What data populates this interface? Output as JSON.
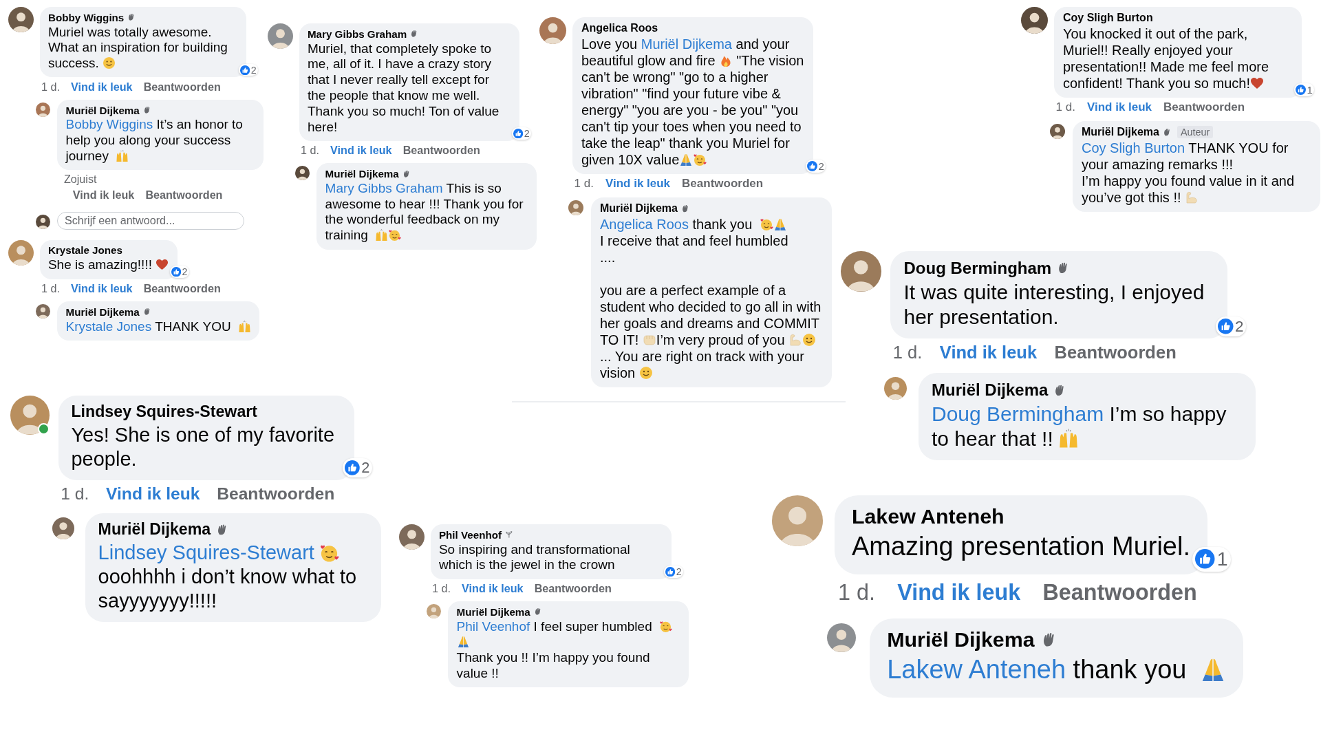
{
  "threads": [
    {
      "comments": [
        {
          "author": "Bobby Wiggins",
          "wave_badge": true,
          "sprout_badge": false,
          "online": false,
          "body": [
            {
              "kind": "text",
              "text": "Muriel was totally awesome. What an inspiration for building success. "
            },
            {
              "kind": "smile"
            }
          ],
          "reactions": "2",
          "time": "1 d.",
          "like_label": "Vind ik leuk",
          "liked": true,
          "reply_label": "Beantwoorden",
          "replies": [
            {
              "author": "Muriël Dijkema",
              "wave_badge": true,
              "sprout_badge": false,
              "body": [
                {
                  "kind": "mention",
                  "text": "Bobby Wiggins"
                },
                {
                  "kind": "text",
                  "text": " It’s an honor to help you along your success journey "
                },
                {
                  "kind": "raised-hands"
                }
              ],
              "time": "Zojuist",
              "like_label": "Vind ik leuk",
              "liked": false,
              "reply_label": "Beantwoorden"
            }
          ],
          "reply_field": {
            "placeholder": "Schrijf een antwoord..."
          }
        },
        {
          "author": "Krystale Jones",
          "wave_badge": false,
          "sprout_badge": false,
          "online": false,
          "body": [
            {
              "kind": "text",
              "text": "She is amazing!!!! "
            },
            {
              "kind": "heart"
            }
          ],
          "reactions": "2",
          "time": "1 d.",
          "like_label": "Vind ik leuk",
          "liked": true,
          "reply_label": "Beantwoorden",
          "replies": [
            {
              "author": "Muriël Dijkema",
              "wave_badge": true,
              "sprout_badge": false,
              "body": [
                {
                  "kind": "mention",
                  "text": "Krystale Jones"
                },
                {
                  "kind": "text",
                  "text": " THANK YOU "
                },
                {
                  "kind": "raised-hands"
                }
              ]
            }
          ]
        }
      ]
    },
    {
      "comments": [
        {
          "author": "Lindsey Squires-Stewart",
          "wave_badge": false,
          "sprout_badge": false,
          "online": true,
          "body": [
            {
              "kind": "text",
              "text": "Yes! She is one of my favorite people."
            }
          ],
          "reactions": "2",
          "time": "1 d.",
          "like_label": "Vind ik leuk",
          "liked": true,
          "reply_label": "Beantwoorden",
          "replies": [
            {
              "author": "Muriël Dijkema",
              "wave_badge": true,
              "sprout_badge": false,
              "body": [
                {
                  "kind": "mention",
                  "text": "Lindsey Squires-Stewart"
                },
                {
                  "kind": "hearts-face"
                },
                {
                  "kind": "text",
                  "text": "\nooohhhh i don’t know what to sayyyyyyy!!!!!"
                }
              ]
            }
          ]
        }
      ]
    },
    {
      "comments": [
        {
          "author": "Mary Gibbs Graham",
          "wave_badge": true,
          "sprout_badge": false,
          "online": false,
          "body": [
            {
              "kind": "text",
              "text": "Muriel, that completely spoke to me, all of it.  I have a crazy story that I never really tell except for the people that know me well. Thank you so much!   Ton of value here!"
            }
          ],
          "reactions": "2",
          "time": "1 d.",
          "like_label": "Vind ik leuk",
          "liked": true,
          "reply_label": "Beantwoorden",
          "replies": [
            {
              "author": "Muriël Dijkema",
              "wave_badge": true,
              "sprout_badge": false,
              "body": [
                {
                  "kind": "mention",
                  "text": "Mary Gibbs Graham"
                },
                {
                  "kind": "text",
                  "text": " This is so awesome to hear !!! Thank you for the wonderful feedback on my training "
                },
                {
                  "kind": "raised-hands"
                },
                {
                  "kind": "hearts-face"
                }
              ]
            }
          ]
        }
      ]
    },
    {
      "comments": [
        {
          "author": "Angelica Roos",
          "wave_badge": false,
          "sprout_badge": false,
          "online": false,
          "body": [
            {
              "kind": "text",
              "text": "Love you "
            },
            {
              "kind": "mention",
              "text": "Muriël Dijkema"
            },
            {
              "kind": "text",
              "text": " and your beautiful glow and fire"
            },
            {
              "kind": "fire"
            },
            {
              "kind": "text",
              "text": " \"The vision can't be wrong\" \"go to a higher vibration\" \"find your future vibe & energy\" \"you are you - be you\" \"you can't tip your toes when you need to take the leap\" thank you  Muriel for given 10X value"
            },
            {
              "kind": "pray"
            },
            {
              "kind": "hearts-face"
            }
          ],
          "reactions": "2",
          "time": "1 d.",
          "like_label": "Vind ik leuk",
          "liked": true,
          "reply_label": "Beantwoorden",
          "replies": [
            {
              "author": "Muriël Dijkema",
              "wave_badge": true,
              "sprout_badge": false,
              "body": [
                {
                  "kind": "mention",
                  "text": "Angelica Roos"
                },
                {
                  "kind": "text",
                  "text": " thank you "
                },
                {
                  "kind": "hearts-face"
                },
                {
                  "kind": "pray"
                },
                {
                  "kind": "text",
                  "text": "\nI receive that and feel humbled\n....\n\nyou are a perfect example of a student who decided to go all in with her goals and dreams and COMMIT TO IT! "
                },
                {
                  "kind": "fist"
                },
                {
                  "kind": "text",
                  "text": "I’m very proud of you "
                },
                {
                  "kind": "muscle"
                },
                {
                  "kind": "smile"
                },
                {
                  "kind": "text",
                  "text": " ... You are right on track with your vision "
                },
                {
                  "kind": "smile"
                }
              ]
            }
          ]
        }
      ]
    },
    {
      "comments": [
        {
          "author": "Phil Veenhof",
          "wave_badge": false,
          "sprout_badge": true,
          "online": false,
          "body": [
            {
              "kind": "text",
              "text": "So inspiring and transformational which is the jewel in the crown"
            }
          ],
          "reactions": "2",
          "time": "1 d.",
          "like_label": "Vind ik leuk",
          "liked": true,
          "reply_label": "Beantwoorden",
          "replies": [
            {
              "author": "Muriël Dijkema",
              "wave_badge": true,
              "sprout_badge": false,
              "body": [
                {
                  "kind": "mention",
                  "text": "Phil Veenhof"
                },
                {
                  "kind": "text",
                  "text": " I feel super humbled "
                },
                {
                  "kind": "hearts-face"
                },
                {
                  "kind": "pray"
                },
                {
                  "kind": "text",
                  "text": "\nThank you !! I’m happy you found value !!"
                }
              ]
            }
          ]
        }
      ]
    },
    {
      "comments": [
        {
          "author": "Coy Sligh Burton",
          "wave_badge": false,
          "sprout_badge": false,
          "online": false,
          "body": [
            {
              "kind": "text",
              "text": "You knocked it out of the park, Muriel!! Really enjoyed your presentation!! Made me feel more confident! Thank you so much!"
            },
            {
              "kind": "heart"
            }
          ],
          "reactions": "1",
          "time": "1 d.",
          "like_label": "Vind ik leuk",
          "liked": true,
          "reply_label": "Beantwoorden",
          "replies": [
            {
              "author": "Muriël Dijkema",
              "wave_badge": true,
              "sprout_badge": false,
              "tag": "Auteur",
              "body": [
                {
                  "kind": "mention",
                  "text": "Coy Sligh Burton"
                },
                {
                  "kind": "text",
                  "text": " THANK YOU for your amazing remarks !!!\nI’m happy you found value in it and you’ve got this !!"
                },
                {
                  "kind": "muscle"
                }
              ]
            }
          ]
        }
      ]
    },
    {
      "comments": [
        {
          "author": "Doug Bermingham",
          "wave_badge": true,
          "sprout_badge": false,
          "online": false,
          "body": [
            {
              "kind": "text",
              "text": "It was quite interesting, I enjoyed her presentation."
            }
          ],
          "reactions": "2",
          "time": "1 d.",
          "like_label": "Vind ik leuk",
          "liked": true,
          "reply_label": "Beantwoorden",
          "replies": [
            {
              "author": "Muriël Dijkema",
              "wave_badge": true,
              "sprout_badge": false,
              "body": [
                {
                  "kind": "mention",
                  "text": "Doug Bermingham"
                },
                {
                  "kind": "text",
                  "text": " I’m so happy to hear that !!"
                },
                {
                  "kind": "raised-hands"
                }
              ]
            }
          ]
        }
      ]
    },
    {
      "comments": [
        {
          "author": "Lakew Anteneh",
          "wave_badge": false,
          "sprout_badge": false,
          "online": false,
          "body": [
            {
              "kind": "text",
              "text": "Amazing presentation Muriel."
            }
          ],
          "reactions": "1",
          "time": "1 d.",
          "like_label": "Vind ik leuk",
          "liked": true,
          "reply_label": "Beantwoorden",
          "replies": [
            {
              "author": "Muriël Dijkema",
              "wave_badge": true,
              "sprout_badge": false,
              "body": [
                {
                  "kind": "mention",
                  "text": "Lakew Anteneh"
                },
                {
                  "kind": "text",
                  "text": " thank you "
                },
                {
                  "kind": "pray"
                }
              ]
            }
          ]
        }
      ]
    }
  ]
}
